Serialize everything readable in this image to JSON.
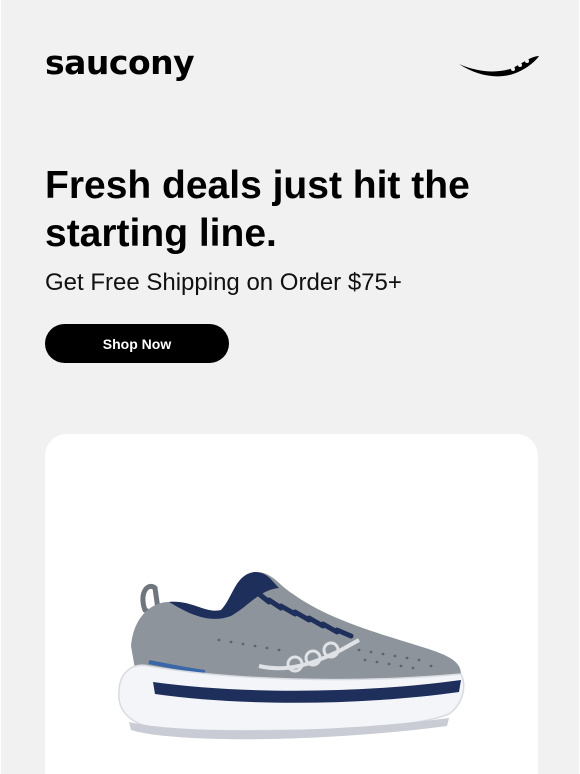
{
  "header": {
    "brand": "saucony",
    "logo_icon": "saucony-dots-swoosh-icon"
  },
  "hero": {
    "headline": "Fresh deals just hit the starting line.",
    "subhead": "Get Free Shipping on Order $75+",
    "cta_label": "Shop Now"
  },
  "product": {
    "image": "grey-navy-running-shoe",
    "colors": {
      "upper": "#8d949b",
      "accent": "#1f2f5c",
      "sole": "#f4f5f8"
    }
  },
  "colors": {
    "background": "#f1f1f1",
    "text": "#000000",
    "button": "#000000",
    "button_text": "#ffffff",
    "card": "#ffffff"
  }
}
